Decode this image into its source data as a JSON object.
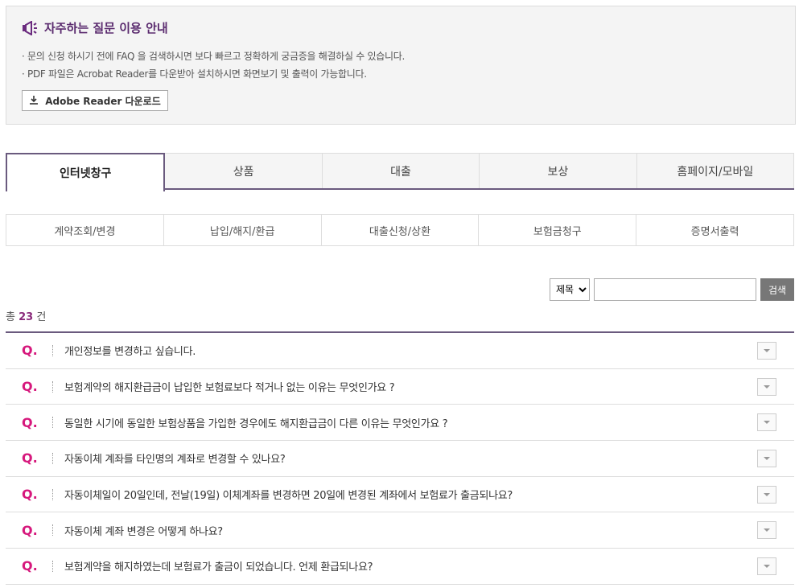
{
  "notice": {
    "title": "자주하는 질문 이용 안내",
    "lines": [
      "· 문의 신청 하시기 전에 FAQ 을 검색하시면 보다 빠르고 정확하게 궁금증을 해결하실 수 있습니다.",
      "· PDF 파일은 Acrobat Reader를 다운받아 설치하시면 화면보기 및 출력이 가능합니다."
    ],
    "download_label": "Adobe Reader 다운로드"
  },
  "tabs": [
    "인터넷창구",
    "상품",
    "대출",
    "보상",
    "홈페이지/모바일"
  ],
  "subtabs": [
    "계약조회/변경",
    "납입/해지/환급",
    "대출신청/상환",
    "보험금청구",
    "증명서출력"
  ],
  "search": {
    "select_value": "제목",
    "button_label": "검색"
  },
  "count": {
    "prefix": "총",
    "number": "23",
    "suffix": "건"
  },
  "faq_marker": "Q.",
  "faq_items": [
    "개인정보를 변경하고 싶습니다.",
    "보험계약의 해지환급금이 납입한 보험료보다 적거나 없는 이유는 무엇인가요 ?",
    "동일한 시기에 동일한 보험상품을 가입한 경우에도 해지환급금이 다른 이유는 무엇인가요 ?",
    "자동이체 계좌를 타인명의 계좌로 변경할 수 있나요?",
    "자동이체일이 20일인데, 전날(19일) 이체계좌를 변경하면 20일에 변경된 계좌에서 보험료가 출금되나요?",
    "자동이체 계좌 변경은 어떻게 하나요?",
    "보험계약을 해지하였는데 보험료가 출금이 되었습니다. 언제 환급되나요?"
  ],
  "colors": {
    "accent": "#6a5a7e",
    "q_marker": "#d6187c",
    "count": "#8b2c7c"
  },
  "icons": {
    "notice": "megaphone-icon",
    "download": "download-icon",
    "toggle": "chevron-down-icon"
  }
}
